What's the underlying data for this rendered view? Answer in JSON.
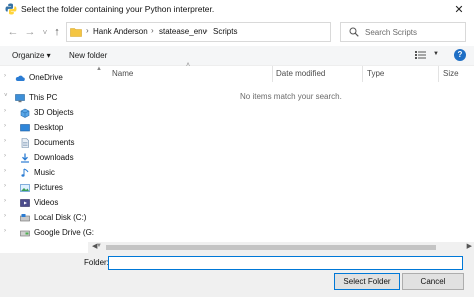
{
  "window": {
    "title": "Select the folder containing your Python interpreter.",
    "close_glyph": "✕",
    "icon": "python-icon"
  },
  "nav": {
    "back_glyph": "←",
    "forward_glyph": "→",
    "recent_glyph": "˅",
    "up_glyph": "↑",
    "breadcrumbs": [
      "Hank Anderson",
      "statease_env",
      "Scripts"
    ],
    "separator": "›",
    "dropdown_glyph": "˅",
    "refresh_glyph": "↻",
    "search_placeholder": "Search Scripts"
  },
  "toolbar": {
    "organize_label": "Organize ▾",
    "new_folder_label": "New folder",
    "view_dropdown_glyph": "▼",
    "help_glyph": "?"
  },
  "sidebar": {
    "items": [
      {
        "label": "OneDrive",
        "icon": "cloud-icon"
      },
      {
        "label": "This PC",
        "icon": "computer-icon"
      },
      {
        "label": "3D Objects",
        "icon": "cube-icon"
      },
      {
        "label": "Desktop",
        "icon": "desktop-icon"
      },
      {
        "label": "Documents",
        "icon": "document-icon"
      },
      {
        "label": "Downloads",
        "icon": "download-icon"
      },
      {
        "label": "Music",
        "icon": "music-icon"
      },
      {
        "label": "Pictures",
        "icon": "picture-icon"
      },
      {
        "label": "Videos",
        "icon": "video-icon"
      },
      {
        "label": "Local Disk (C:)",
        "icon": "drive-icon"
      },
      {
        "label": "Google Drive (G:",
        "icon": "google-drive-icon"
      }
    ]
  },
  "columns": [
    "Name",
    "Date modified",
    "Type",
    "Size"
  ],
  "empty_message": "No items match your search.",
  "footer": {
    "folder_label": "Folder:",
    "folder_value": "",
    "select_button": "Select Folder",
    "cancel_button": "Cancel"
  },
  "colors": {
    "accent": "#0078d7",
    "folder": "#f4c542",
    "python_blue": "#3572a5",
    "python_yellow": "#ffd43b"
  }
}
